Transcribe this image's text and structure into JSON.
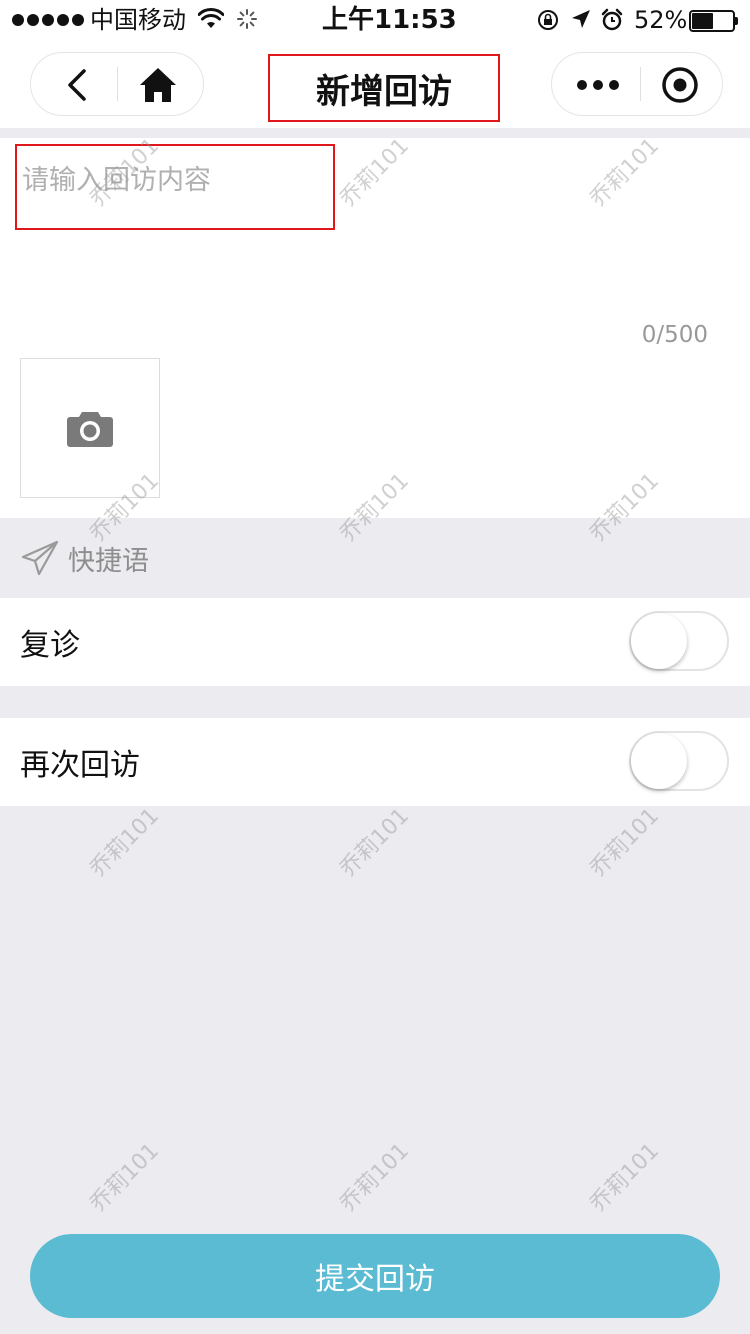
{
  "status_bar": {
    "carrier": "中国移动",
    "time": "上午11:53",
    "battery_percent": "52%",
    "battery_level": 0.52,
    "icons": [
      "signal-dots-icon",
      "wifi-icon",
      "loading-icon",
      "rotation-lock-icon",
      "location-arrow-icon",
      "alarm-icon",
      "battery-icon"
    ]
  },
  "nav": {
    "title": "新增回访",
    "back_icon": "chevron-left-icon",
    "home_icon": "home-icon",
    "more_icon": "more-dots-icon",
    "target_icon": "target-circle-icon"
  },
  "form": {
    "content_placeholder": "请输入回访内容",
    "content_value": "",
    "char_count": "0/500",
    "photo_icon": "camera-icon"
  },
  "quick_phrases": {
    "label": "快捷语",
    "icon": "paper-plane-icon"
  },
  "switches": [
    {
      "label": "复诊",
      "on": false
    },
    {
      "label": "再次回访",
      "on": false
    }
  ],
  "submit_label": "提交回访",
  "watermark": "乔莉101",
  "colors": {
    "accent": "#5bbbd3",
    "highlight_red": "#e0171b",
    "background": "#ebebf0"
  }
}
